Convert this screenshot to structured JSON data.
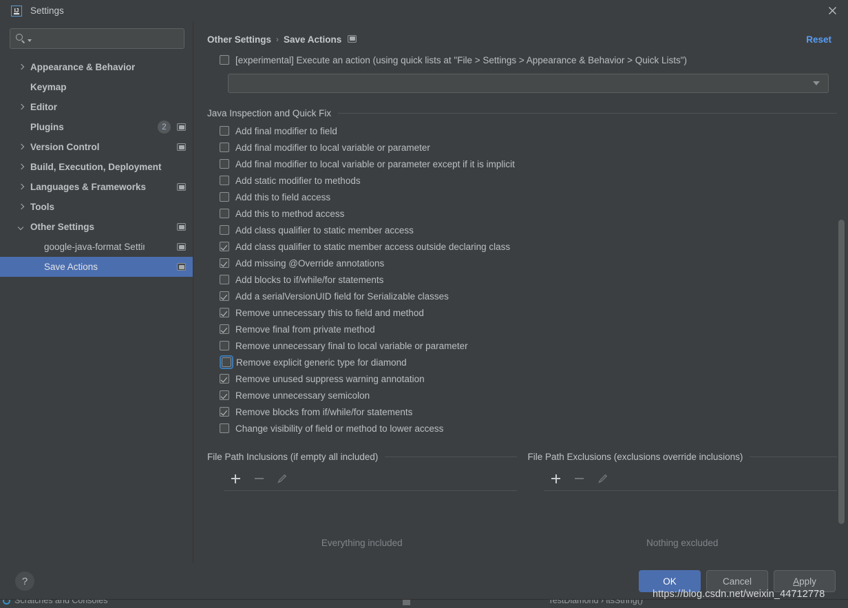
{
  "window": {
    "title": "Settings",
    "app_icon": "intellij-idea-icon",
    "close_icon": "close-icon"
  },
  "sidebar": {
    "search": {
      "value": "",
      "placeholder": "",
      "icon": "search-icon"
    },
    "items": [
      {
        "label": "Appearance & Behavior",
        "arrow": "right",
        "bold": true,
        "child": false,
        "badge": null,
        "module_icon": false
      },
      {
        "label": "Keymap",
        "arrow": "none",
        "bold": true,
        "child": false,
        "badge": null,
        "module_icon": false
      },
      {
        "label": "Editor",
        "arrow": "right",
        "bold": true,
        "child": false,
        "badge": null,
        "module_icon": false
      },
      {
        "label": "Plugins",
        "arrow": "none",
        "bold": true,
        "child": false,
        "badge": "2",
        "module_icon": true
      },
      {
        "label": "Version Control",
        "arrow": "right",
        "bold": true,
        "child": false,
        "badge": null,
        "module_icon": true
      },
      {
        "label": "Build, Execution, Deployment",
        "arrow": "right",
        "bold": true,
        "child": false,
        "badge": null,
        "module_icon": false
      },
      {
        "label": "Languages & Frameworks",
        "arrow": "right",
        "bold": true,
        "child": false,
        "badge": null,
        "module_icon": true
      },
      {
        "label": "Tools",
        "arrow": "right",
        "bold": true,
        "child": false,
        "badge": null,
        "module_icon": false
      },
      {
        "label": "Other Settings",
        "arrow": "down",
        "bold": true,
        "child": false,
        "badge": null,
        "module_icon": true
      },
      {
        "label": "google-java-format Settings",
        "arrow": "none",
        "bold": false,
        "child": true,
        "badge": null,
        "module_icon": true
      },
      {
        "label": "Save Actions",
        "arrow": "none",
        "bold": false,
        "child": true,
        "badge": null,
        "module_icon": true,
        "selected": true
      }
    ]
  },
  "header": {
    "breadcrumb": [
      "Other Settings",
      "Save Actions"
    ],
    "breadcrumb_separator": "›",
    "breadcrumb_icon": "module-settings-icon",
    "reset_label": "Reset"
  },
  "experimental": {
    "label": "[experimental] Execute an action (using quick lists at \"File > Settings > Appearance & Behavior > Quick Lists\")",
    "checked": false,
    "combo_value": "",
    "combo_icon": "chevron-down-icon"
  },
  "java_section": {
    "title": "Java Inspection and Quick Fix",
    "options": [
      {
        "label": "Add final modifier to field",
        "checked": false,
        "focused": false
      },
      {
        "label": "Add final modifier to local variable or parameter",
        "checked": false,
        "focused": false
      },
      {
        "label": "Add final modifier to local variable or parameter except if it is implicit",
        "checked": false,
        "focused": false
      },
      {
        "label": "Add static modifier to methods",
        "checked": false,
        "focused": false
      },
      {
        "label": "Add this to field access",
        "checked": false,
        "focused": false
      },
      {
        "label": "Add this to method access",
        "checked": false,
        "focused": false
      },
      {
        "label": "Add class qualifier to static member access",
        "checked": false,
        "focused": false
      },
      {
        "label": "Add class qualifier to static member access outside declaring class",
        "checked": true,
        "focused": false
      },
      {
        "label": "Add missing @Override annotations",
        "checked": true,
        "focused": false
      },
      {
        "label": "Add blocks to if/while/for statements",
        "checked": false,
        "focused": false
      },
      {
        "label": "Add a serialVersionUID field for Serializable classes",
        "checked": true,
        "focused": false
      },
      {
        "label": "Remove unnecessary this to field and method",
        "checked": true,
        "focused": false
      },
      {
        "label": "Remove final from private method",
        "checked": true,
        "focused": false
      },
      {
        "label": "Remove unnecessary final to local variable or parameter",
        "checked": false,
        "focused": false
      },
      {
        "label": "Remove explicit generic type for diamond",
        "checked": false,
        "focused": true
      },
      {
        "label": "Remove unused suppress warning annotation",
        "checked": true,
        "focused": false
      },
      {
        "label": "Remove unnecessary semicolon",
        "checked": true,
        "focused": false
      },
      {
        "label": "Remove blocks from if/while/for statements",
        "checked": true,
        "focused": false
      },
      {
        "label": "Change visibility of field or method to lower access",
        "checked": false,
        "focused": false
      }
    ]
  },
  "inclusions": {
    "title": "File Path Inclusions (if empty all included)",
    "add_icon": "plus-icon",
    "remove_icon": "minus-icon",
    "edit_icon": "pencil-icon",
    "empty_text": "Everything included"
  },
  "exclusions": {
    "title": "File Path Exclusions (exclusions override inclusions)",
    "add_icon": "plus-icon",
    "remove_icon": "minus-icon",
    "edit_icon": "pencil-icon",
    "empty_text": "Nothing excluded"
  },
  "footer": {
    "help_label": "?",
    "ok_label": "OK",
    "cancel_label": "Cancel",
    "apply_mnemonic": "A",
    "apply_rest": "pply"
  },
  "background": {
    "left_tool_label": "Scratches and Consoles",
    "breadcrumb_text": "TestDiamond  ›  itsString()"
  },
  "watermark": "https://blog.csdn.net/weixin_44712778",
  "colors": {
    "dialog_bg": "#3c3f41",
    "selection": "#4b6eaf",
    "accent_link": "#589df6",
    "focus_ring": "#3d7ab5",
    "text": "#bcbfc1",
    "muted_text": "#81858a"
  }
}
